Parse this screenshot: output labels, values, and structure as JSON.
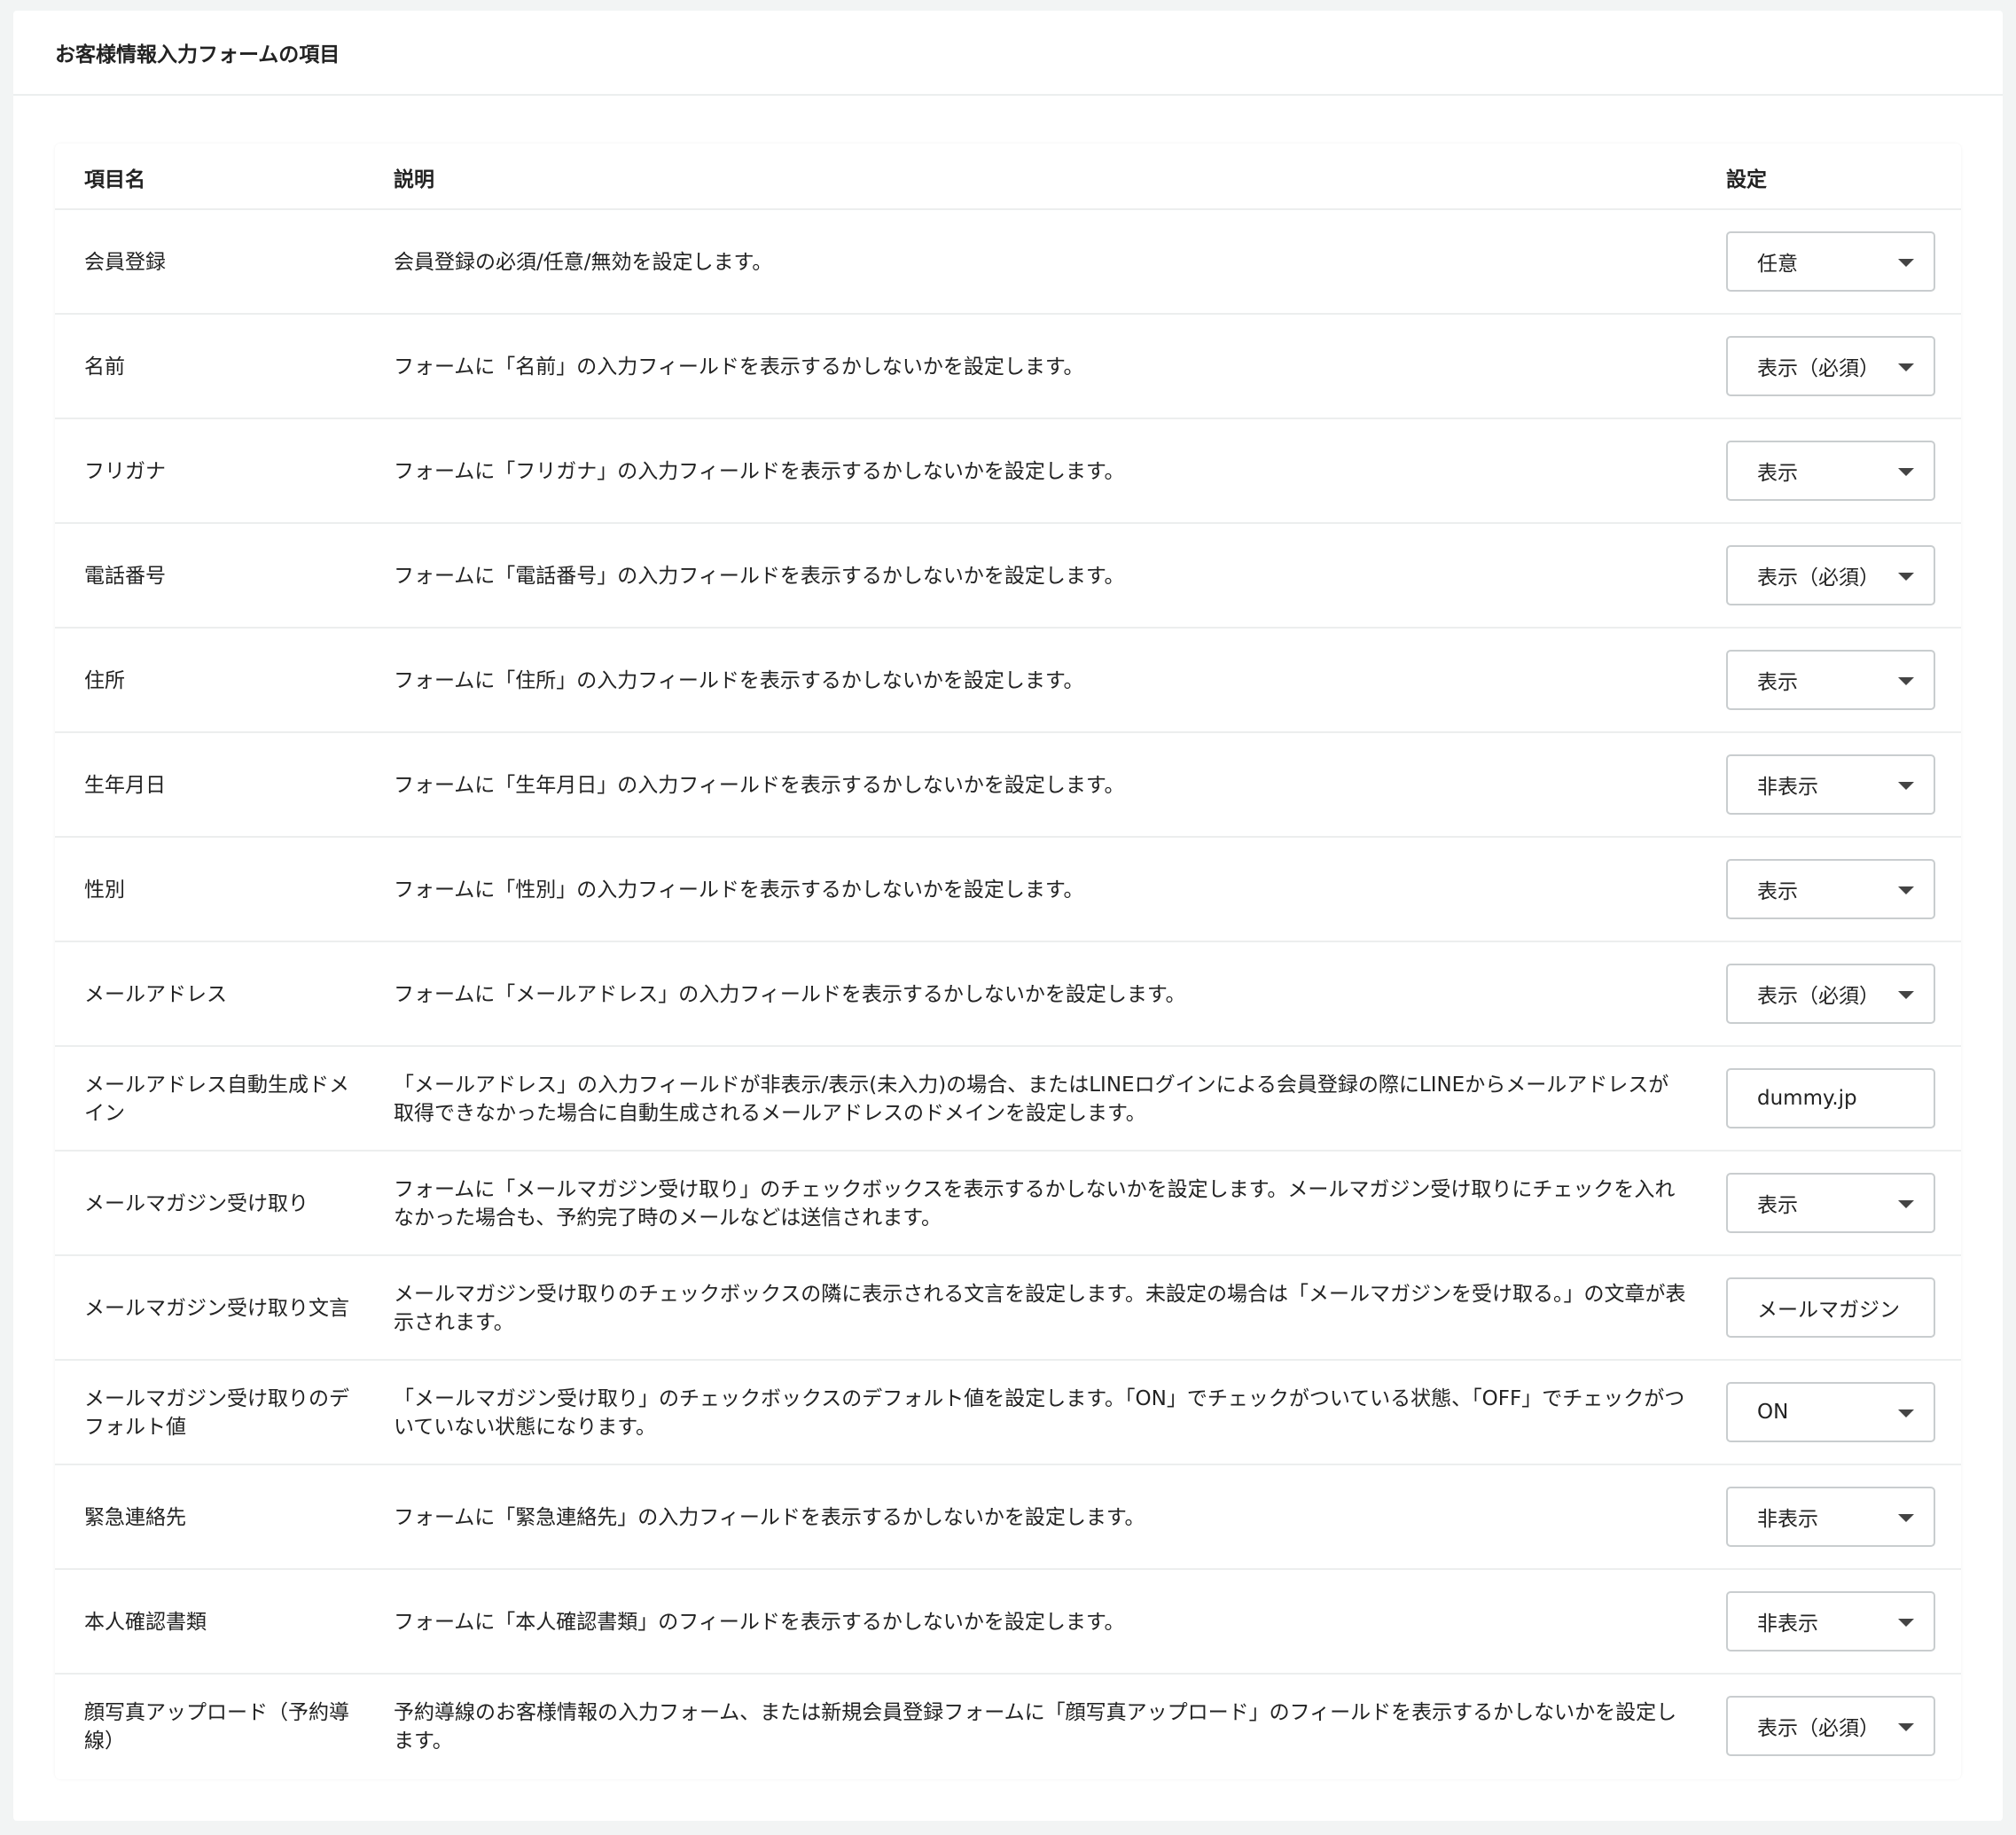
{
  "panel": {
    "title": "お客様情報入力フォームの項目"
  },
  "table": {
    "headers": {
      "name": "項目名",
      "description": "説明",
      "setting": "設定"
    },
    "rows": [
      {
        "name": "会員登録",
        "description": "会員登録の必須/任意/無効を設定します。",
        "value": "任意",
        "control": "select"
      },
      {
        "name": "名前",
        "description": "フォームに「名前」の入力フィールドを表示するかしないかを設定します。",
        "value": "表示（必須）",
        "control": "select"
      },
      {
        "name": "フリガナ",
        "description": "フォームに「フリガナ」の入力フィールドを表示するかしないかを設定します。",
        "value": "表示",
        "control": "select"
      },
      {
        "name": "電話番号",
        "description": "フォームに「電話番号」の入力フィールドを表示するかしないかを設定します。",
        "value": "表示（必須）",
        "control": "select"
      },
      {
        "name": "住所",
        "description": "フォームに「住所」の入力フィールドを表示するかしないかを設定します。",
        "value": "表示",
        "control": "select"
      },
      {
        "name": "生年月日",
        "description": "フォームに「生年月日」の入力フィールドを表示するかしないかを設定します。",
        "value": "非表示",
        "control": "select"
      },
      {
        "name": "性別",
        "description": "フォームに「性別」の入力フィールドを表示するかしないかを設定します。",
        "value": "表示",
        "control": "select"
      },
      {
        "name": "メールアドレス",
        "description": "フォームに「メールアドレス」の入力フィールドを表示するかしないかを設定します。",
        "value": "表示（必須）",
        "control": "select"
      },
      {
        "name": "メールアドレス自動生成ドメイン",
        "description": "「メールアドレス」の入力フィールドが非表示/表示(未入力)の場合、またはLINEログインによる会員登録の際にLINEからメールアドレスが取得できなかった場合に自動生成されるメールアドレスのドメインを設定します。",
        "value": "dummy.jp",
        "control": "input"
      },
      {
        "name": "メールマガジン受け取り",
        "description": "フォームに「メールマガジン受け取り」のチェックボックスを表示するかしないかを設定します。メールマガジン受け取りにチェックを入れなかった場合も、予約完了時のメールなどは送信されます。",
        "value": "表示",
        "control": "select"
      },
      {
        "name": "メールマガジン受け取り文言",
        "description": "メールマガジン受け取りのチェックボックスの隣に表示される文言を設定します。未設定の場合は「メールマガジンを受け取る。」の文章が表示されます。",
        "value": "メールマガジン",
        "control": "input"
      },
      {
        "name": "メールマガジン受け取りのデフォルト値",
        "description": "「メールマガジン受け取り」のチェックボックスのデフォルト値を設定します。「ON」でチェックがついている状態、「OFF」でチェックがついていない状態になります。",
        "value": "ON",
        "control": "select"
      },
      {
        "name": "緊急連絡先",
        "description": "フォームに「緊急連絡先」の入力フィールドを表示するかしないかを設定します。",
        "value": "非表示",
        "control": "select"
      },
      {
        "name": "本人確認書類",
        "description": "フォームに「本人確認書類」のフィールドを表示するかしないかを設定します。",
        "value": "非表示",
        "control": "select"
      },
      {
        "name": "顔写真アップロード（予約導線）",
        "description": "予約導線のお客様情報の入力フォーム、または新規会員登録フォームに「顔写真アップロード」のフィールドを表示するかしないかを設定します。",
        "value": "表示（必須）",
        "control": "select"
      }
    ]
  }
}
